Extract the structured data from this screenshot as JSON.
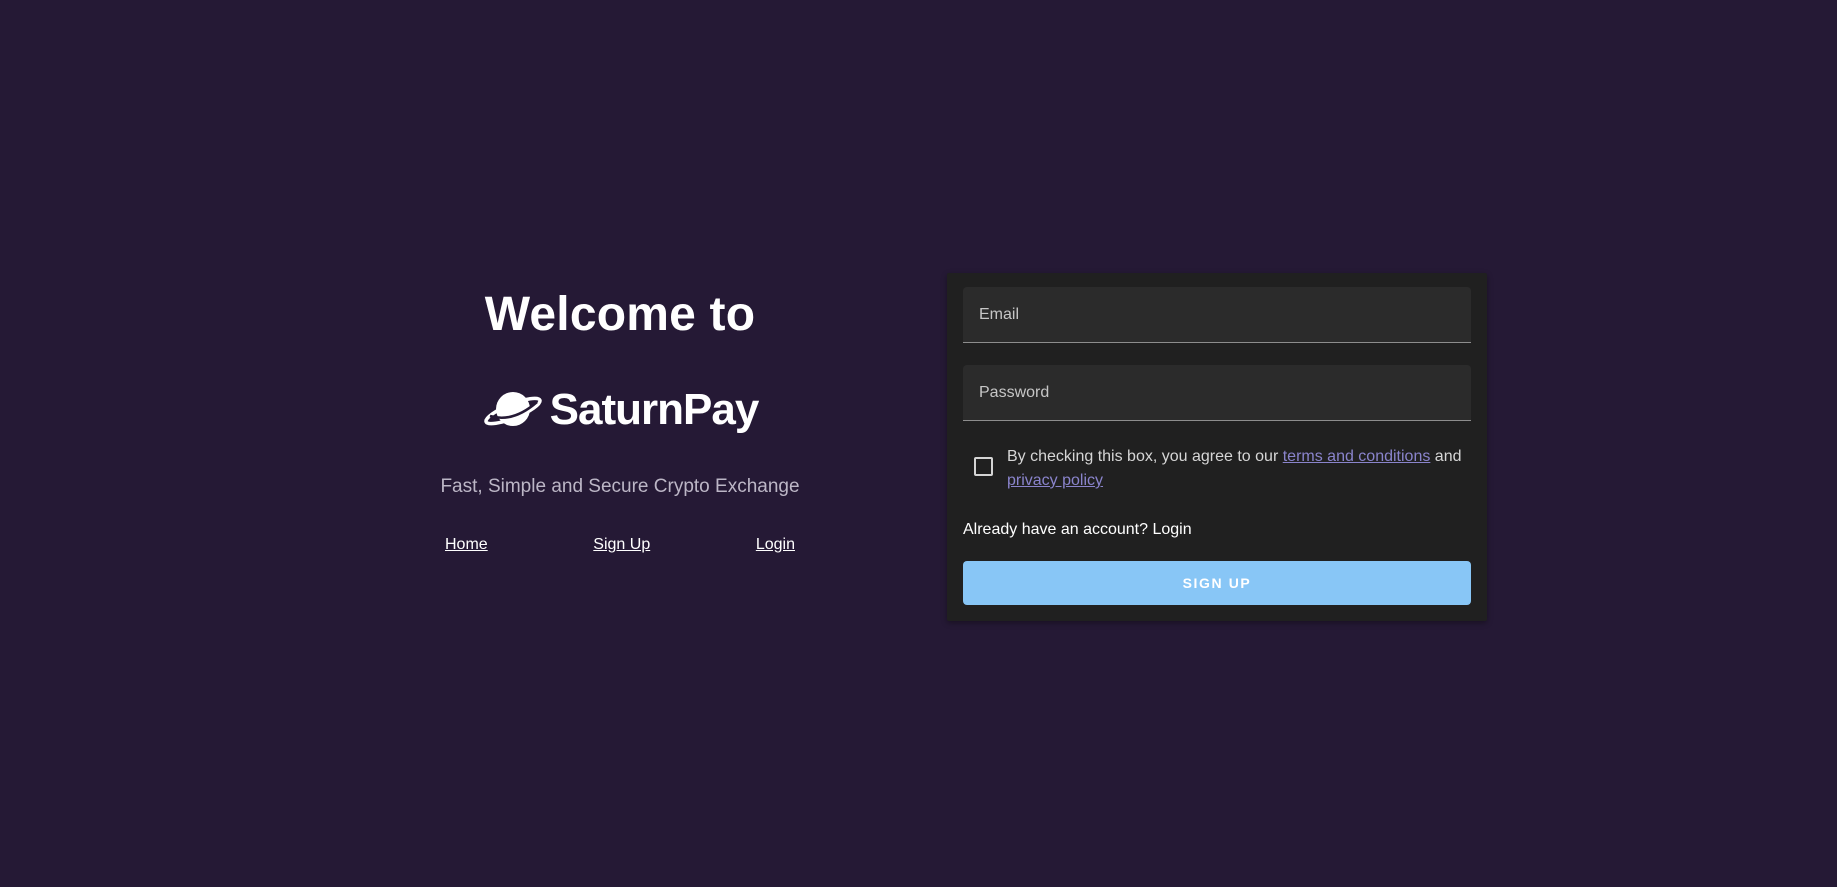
{
  "hero": {
    "title": "Welcome to",
    "brand_name": "SaturnPay",
    "tagline": "Fast, Simple and Secure Crypto Exchange",
    "nav": [
      {
        "label": "Home"
      },
      {
        "label": "Sign Up"
      },
      {
        "label": "Login"
      }
    ]
  },
  "form": {
    "email_placeholder": "Email",
    "email_value": "",
    "password_placeholder": "Password",
    "password_value": "",
    "consent": {
      "checked": false,
      "prefix": "By checking this box, you agree to our ",
      "terms_link": "terms and conditions",
      "middle": " and ",
      "privacy_link": "privacy policy"
    },
    "login_prompt": "Already have an account? Login",
    "submit_label": "SIGN UP"
  },
  "colors": {
    "background": "#251935",
    "card": "#202020",
    "field": "#2b2b2b",
    "button": "#88c6f6",
    "link": "#8a84cc"
  },
  "icons": {
    "logo": "saturn-planet-icon"
  }
}
